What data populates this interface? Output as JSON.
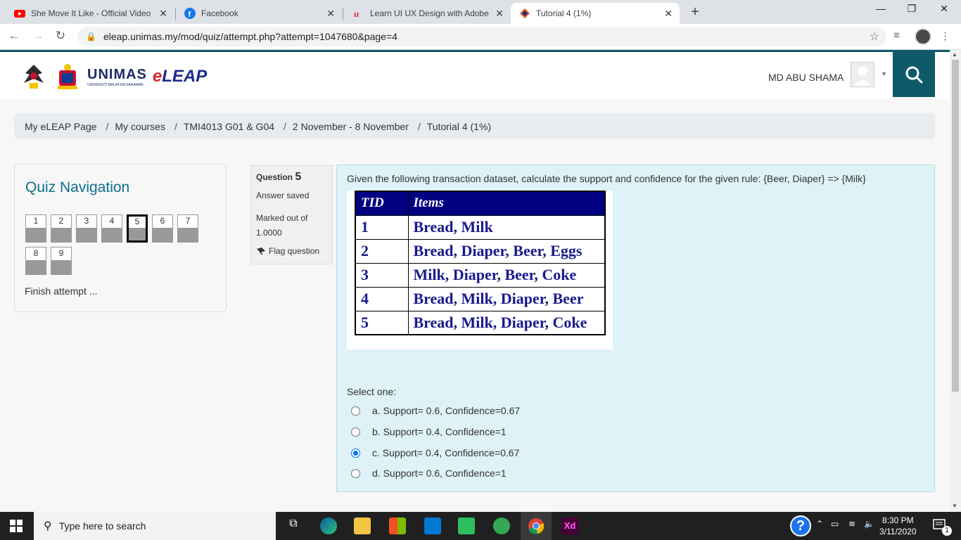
{
  "browser": {
    "tabs": [
      {
        "title": "She Move It Like - Official Video",
        "icon": "youtube-icon",
        "color": "#ff0000"
      },
      {
        "title": "Facebook",
        "icon": "facebook-icon",
        "color": "#1877f2"
      },
      {
        "title": "Learn UI UX Design with Adobe X",
        "icon": "udemy-icon",
        "color": "#e0283a"
      },
      {
        "title": "Tutorial 4 (1%)",
        "icon": "eleap-icon",
        "color": "#e25d1b"
      }
    ],
    "tab_close": "✕",
    "new_tab": "+",
    "window_controls": {
      "minimize": "—",
      "restore": "❐",
      "close": "✕"
    },
    "url": "eleap.unimas.my/mod/quiz/attempt.php?attempt=1047680&page=4"
  },
  "header": {
    "brand": "UNIMAS",
    "brand_sub": "UNIVERSITI MALAYSIA SARAWAK",
    "eleap_prefix": "e",
    "eleap_main": "LEAP",
    "user_name": "MD ABU SHAMA",
    "accent_color": "#0e5a6b"
  },
  "breadcrumb": [
    "My eLEAP Page",
    "My courses",
    "TMI4013 G01 & G04",
    "2 November - 8 November",
    "Tutorial 4 (1%)"
  ],
  "breadcrumb_sep": "/",
  "quiz_nav": {
    "title": "Quiz Navigation",
    "questions": [
      "1",
      "2",
      "3",
      "4",
      "5",
      "6",
      "7",
      "8",
      "9"
    ],
    "current": "5",
    "finish_label": "Finish attempt ..."
  },
  "question_info": {
    "label": "Question",
    "number": "5",
    "state": "Answer saved",
    "marked_label": "Marked out of",
    "marked_value": "1.0000",
    "flag_label": "Flag question"
  },
  "question": {
    "text": "Given the following transaction dataset, calculate the support and confidence for the given rule: {Beer, Diaper} => {Milk}",
    "table": {
      "headers": [
        "TID",
        "Items"
      ],
      "rows": [
        [
          "1",
          "Bread, Milk"
        ],
        [
          "2",
          "Bread, Diaper, Beer, Eggs"
        ],
        [
          "3",
          "Milk, Diaper, Beer, Coke"
        ],
        [
          "4",
          "Bread, Milk, Diaper, Beer"
        ],
        [
          "5",
          "Bread, Milk, Diaper, Coke"
        ]
      ]
    },
    "prompt": "Select one:",
    "options": [
      "a. Support= 0.6, Confidence=0.67",
      "b. Support= 0.4, Confidence=1",
      "c. Support= 0.4, Confidence=0.67",
      "d. Support= 0.6, Confidence=1"
    ],
    "selected_index": 2
  },
  "taskbar": {
    "search_placeholder": "Type here to search",
    "time": "8:30 PM",
    "date": "3/11/2020",
    "notification_count": "1",
    "xd_label": "Xd"
  }
}
